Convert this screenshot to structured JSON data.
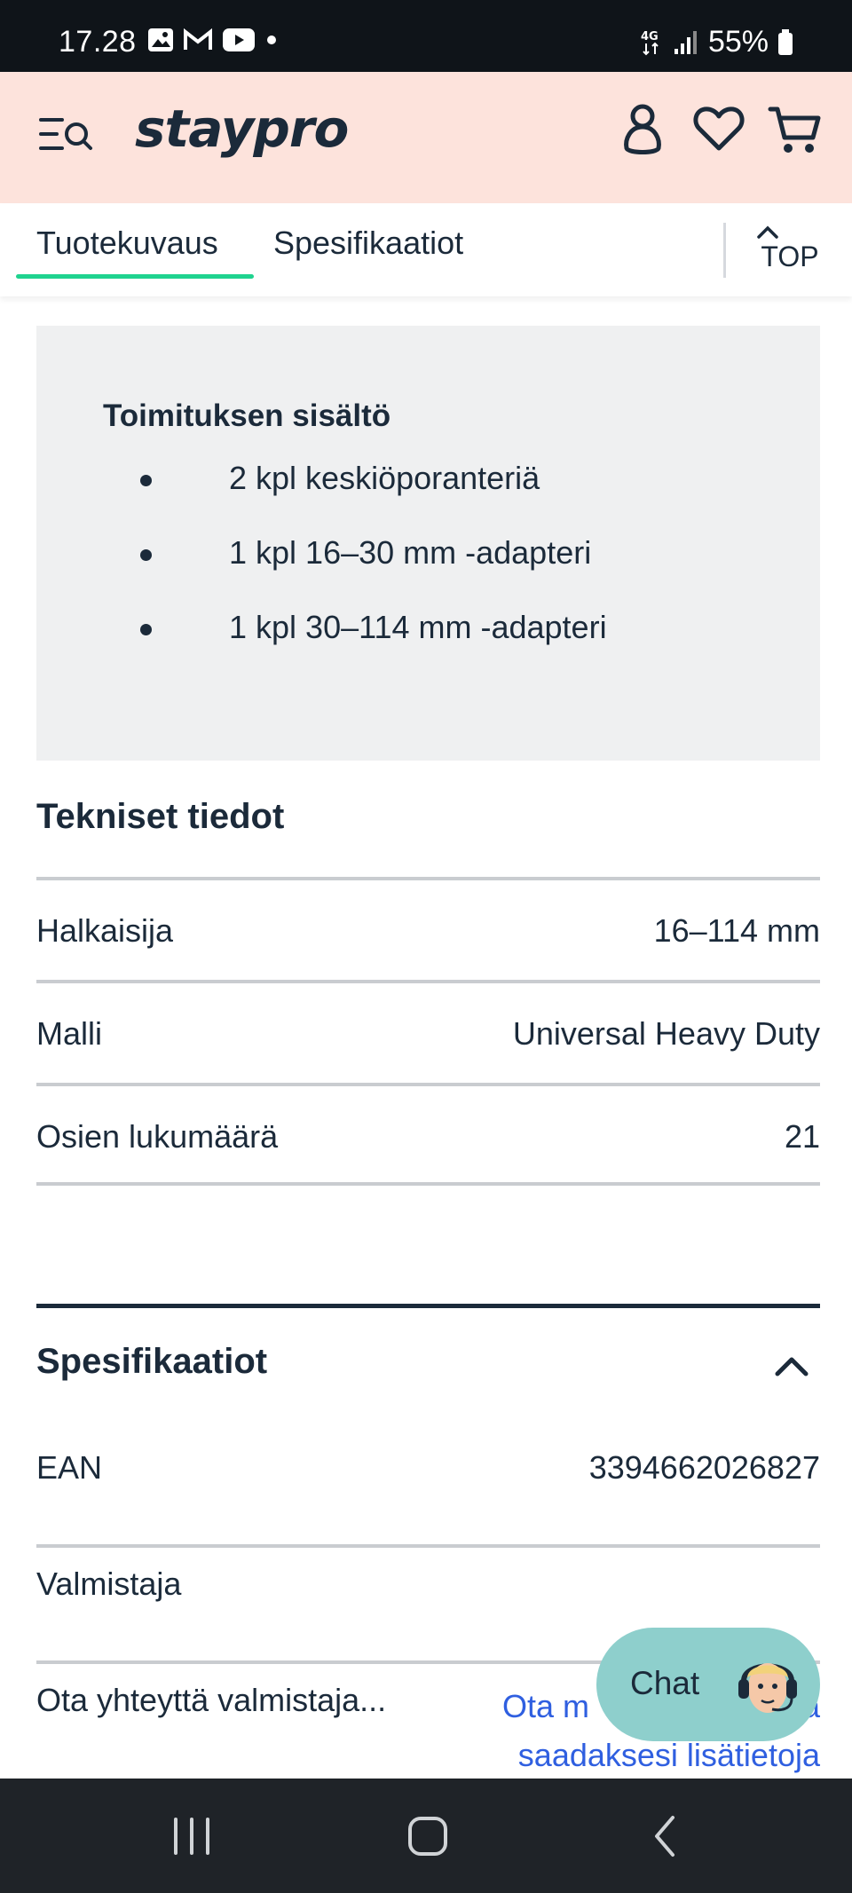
{
  "status_bar": {
    "time": "17.28",
    "network": "4G",
    "battery": "55%"
  },
  "header": {
    "logo": "staypro"
  },
  "tabs": [
    {
      "label": "Tuotekuvaus",
      "active": true
    },
    {
      "label": "Spesifikaatiot",
      "active": false
    }
  ],
  "top_button": {
    "label": "TOP"
  },
  "delivery": {
    "title": "Toimituksen sisältö",
    "items": [
      "2 kpl keskiöporanteriä",
      "1 kpl 16–30 mm -adapteri",
      "1 kpl 30–114 mm -adapteri"
    ]
  },
  "tech": {
    "title": "Tekniset tiedot",
    "rows": [
      {
        "key": "Halkaisija",
        "value": "16–114 mm"
      },
      {
        "key": "Malli",
        "value": "Universal Heavy Duty"
      },
      {
        "key": "Osien lukumäärä",
        "value": "21"
      }
    ]
  },
  "spec": {
    "title": "Spesifikaatiot",
    "rows": [
      {
        "key": "EAN",
        "value": "3394662026827"
      },
      {
        "key": "Valmistaja",
        "value": ""
      }
    ],
    "contact": {
      "key": "Ota yhteyttä valmistaja...",
      "link_line1": "Ota m",
      "link_line1_end": "a",
      "link_line2": "saadaksesi lisätietoja"
    }
  },
  "chat": {
    "label": "Chat"
  },
  "colors": {
    "header_bg": "#fde3dc",
    "tab_indicator": "#1fd38f",
    "chat_bg": "#8ecfcc",
    "link": "#2f5fe0",
    "text": "#1b2a3a"
  }
}
